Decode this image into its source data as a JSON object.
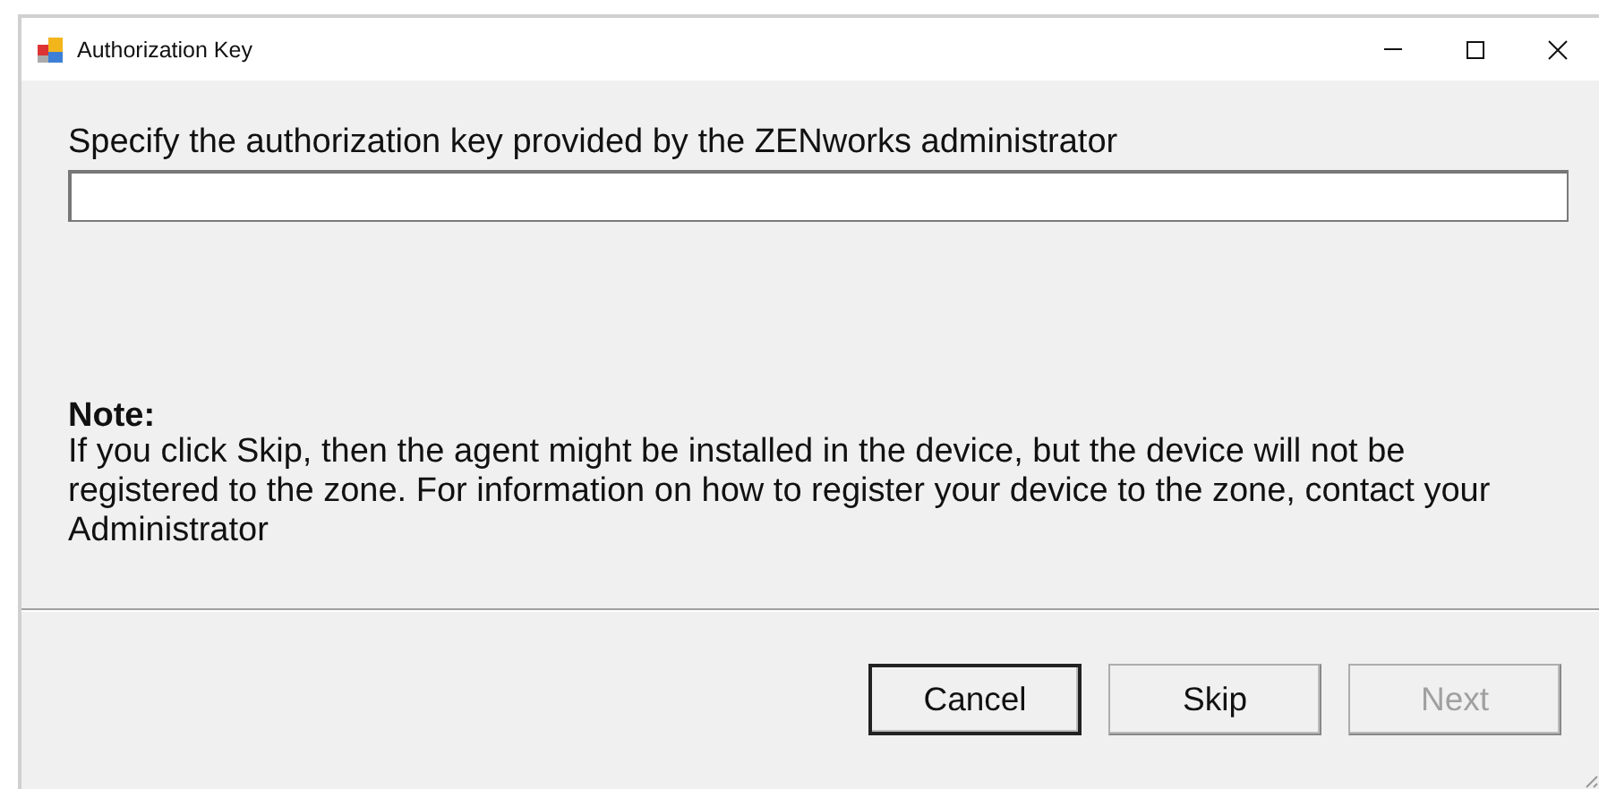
{
  "window": {
    "title": "Authorization Key"
  },
  "prompt": "Specify the authorization key provided by the ZENworks administrator",
  "note": {
    "heading": "Note:",
    "text": "If you click Skip, then the agent might be installed in the device, but the device will not be registered to the zone. For information on how to register your device to the zone, contact your Administrator"
  },
  "buttons": [
    {
      "label": "Cancel",
      "default": true,
      "disabled": false
    },
    {
      "label": "Skip",
      "default": false,
      "disabled": false
    },
    {
      "label": "Next",
      "default": false,
      "disabled": true
    }
  ]
}
